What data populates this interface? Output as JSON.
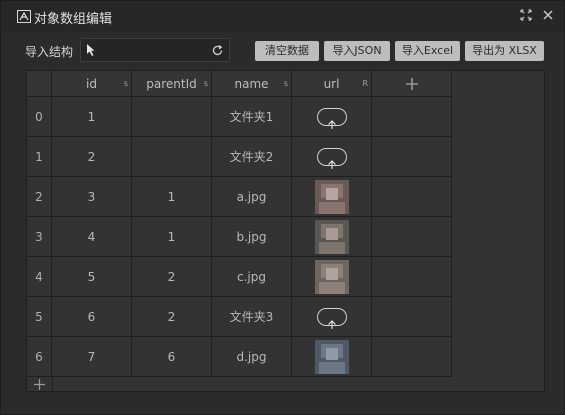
{
  "window": {
    "title": "对象数组编辑"
  },
  "toolbar": {
    "struct_label": "导入结构",
    "clear_label": "清空数据",
    "import_json_label": "导入JSON",
    "import_excel_label": "导入Excel",
    "export_xlsx_label": "导出为 XLSX"
  },
  "table": {
    "columns": [
      {
        "name": "id",
        "type": "s"
      },
      {
        "name": "parentId",
        "type": "s"
      },
      {
        "name": "name",
        "type": "s"
      },
      {
        "name": "url",
        "type": "R"
      }
    ],
    "rows": [
      {
        "index": "0",
        "id": "1",
        "parentId": "",
        "name": "文件夹1",
        "url_kind": "upload"
      },
      {
        "index": "1",
        "id": "2",
        "parentId": "",
        "name": "文件夹2",
        "url_kind": "upload"
      },
      {
        "index": "2",
        "id": "3",
        "parentId": "1",
        "name": "a.jpg",
        "url_kind": "image"
      },
      {
        "index": "3",
        "id": "4",
        "parentId": "1",
        "name": "b.jpg",
        "url_kind": "image"
      },
      {
        "index": "4",
        "id": "5",
        "parentId": "2",
        "name": "c.jpg",
        "url_kind": "image"
      },
      {
        "index": "5",
        "id": "6",
        "parentId": "2",
        "name": "文件夹3",
        "url_kind": "upload"
      },
      {
        "index": "6",
        "id": "7",
        "parentId": "6",
        "name": "d.jpg",
        "url_kind": "image"
      }
    ]
  },
  "icons": {
    "app": "table-edit-icon",
    "maximize": "maximize-icon",
    "close": "close-icon",
    "cursor": "cursor-arrow-icon",
    "refresh": "refresh-icon",
    "add_column": "plus-icon",
    "add_row": "plus-icon",
    "upload": "upload-arrow-icon"
  },
  "colors": {
    "background": "#2b2b2b",
    "grid": "#333333",
    "button": "#bdbdbd"
  }
}
